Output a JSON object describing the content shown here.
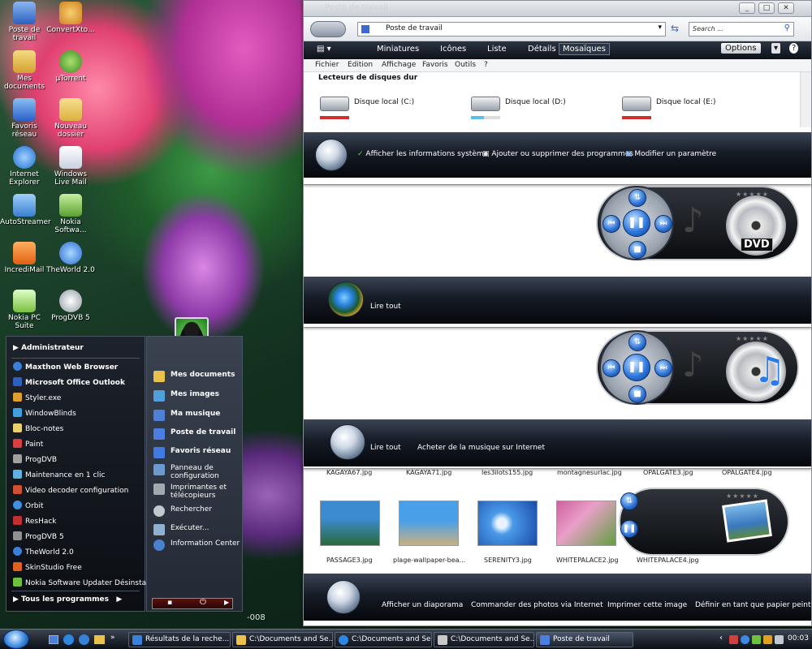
{
  "desktop_icons": [
    {
      "label": "Poste de travail",
      "color": "#4a7ee0"
    },
    {
      "label": "ConvertXto...",
      "color": "#e59a2b"
    },
    {
      "label": "Mes documents",
      "color": "#e8c24a"
    },
    {
      "label": "µTorrent",
      "color": "#6ab04c"
    },
    {
      "label": "Favoris réseau",
      "color": "#3f7be0"
    },
    {
      "label": "Nouveau dossier",
      "color": "#e9c75a"
    },
    {
      "label": "Internet Explorer",
      "color": "#2f86e0"
    },
    {
      "label": "Windows Live Mail",
      "color": "#e8e8f0"
    },
    {
      "label": "AutoStreamer",
      "color": "#56a3e8"
    },
    {
      "label": "Nokia Softwa...",
      "color": "#7dc242"
    },
    {
      "label": "IncrediMail",
      "color": "#f08a2a"
    },
    {
      "label": "TheWorld 2.0",
      "color": "#3a7fd8"
    },
    {
      "label": "Nokia PC Suite",
      "color": "#9bd06a"
    },
    {
      "label": "ProgDVB 5",
      "color": "#cfcfcf"
    }
  ],
  "explorer": {
    "title": "Poste de travail",
    "address": "Poste de travail",
    "search_placeholder": "Search ...",
    "toolbar": {
      "miniatures": "Miniatures",
      "icones": "Icônes",
      "liste": "Liste",
      "details": "Détails",
      "mosaiques": "Mosaïques",
      "options": "Options"
    },
    "menu": [
      "Fichier",
      "Edition",
      "Affichage",
      "Favoris",
      "Outils",
      "?"
    ],
    "group_header": "Lecteurs de disques dur",
    "drives": [
      {
        "label": "Disque local (C:)",
        "bar_color": "#d03030",
        "fill": 1.0
      },
      {
        "label": "Disque local (D:)",
        "bar_color": "#5ac0e8",
        "fill": 0.45
      },
      {
        "label": "Disque local (E:)",
        "bar_color": "#d03030",
        "fill": 1.0
      }
    ],
    "tasks": [
      "Afficher les informations système",
      "Ajouter ou supprimer des programmes",
      "Modifier un paramètre"
    ]
  },
  "video_pane": {
    "stars": "★★★★★",
    "disc_label": "DVD",
    "task": "Lire tout"
  },
  "music_pane": {
    "stars": "★★★★★",
    "tasks": [
      "Lire tout",
      "Acheter de la musique sur Internet"
    ]
  },
  "picture_pane": {
    "top_captions": [
      "KAGAYA67.jpg",
      "KAGAYA71.jpg",
      "les3ilots155.jpg",
      "montagnesurlac.jpg",
      "OPALGATE3.jpg",
      "OPALGATE4.jpg"
    ],
    "thumbs": [
      {
        "caption": "PASSAGE3.jpg",
        "c1": "#3c8ad0",
        "c2": "#2a6a3a"
      },
      {
        "caption": "plage-wallpaper-bea...",
        "c1": "#4aa0e8",
        "c2": "#c8b080"
      },
      {
        "caption": "SERENITY3.jpg",
        "c1": "#2870d8",
        "c2": "#9ad0ff"
      },
      {
        "caption": "WHITEPALACE2.jpg",
        "c1": "#d060a0",
        "c2": "#60a040"
      },
      {
        "caption": "WHITEPALACE4.jpg",
        "c1": "#c8d8f0",
        "c2": "#806898"
      }
    ],
    "stars": "★★★★★",
    "tasks": [
      "Afficher un diaporama",
      "Commander des photos via Internet",
      "Imprimer cette image",
      "Définir en tant que papier peint!"
    ]
  },
  "start_menu": {
    "user": "Administrateur",
    "items": [
      {
        "label": "Maxthon Web Browser",
        "color": "#3a7fd8"
      },
      {
        "label": "Microsoft Office Outlook",
        "color": "#2c5fbf"
      },
      {
        "label": "Styler.exe",
        "color": "#e0a030"
      },
      {
        "label": "WindowBlinds",
        "color": "#3fa0e0"
      },
      {
        "label": "Bloc-notes",
        "color": "#e8d070"
      },
      {
        "label": "Paint",
        "color": "#d84040"
      },
      {
        "label": "ProgDVB",
        "color": "#a0a0a0"
      },
      {
        "label": "Maintenance en 1 clic",
        "color": "#60b0e0"
      },
      {
        "label": "Video decoder configuration",
        "color": "#d05030"
      },
      {
        "label": "Orbit",
        "color": "#4090e0"
      },
      {
        "label": "ResHack",
        "color": "#c03030"
      },
      {
        "label": "ProgDVB 5",
        "color": "#909090"
      },
      {
        "label": "TheWorld 2.0",
        "color": "#3a7fd8"
      },
      {
        "label": "SkinStudio Free",
        "color": "#e06020"
      },
      {
        "label": "Nokia Software Updater Désinsta...",
        "color": "#70c040"
      }
    ],
    "all_programs": "Tous les programmes",
    "right": [
      {
        "label": "Mes documents",
        "color": "#e8c24a"
      },
      {
        "label": "Mes images",
        "color": "#4fa0d8"
      },
      {
        "label": "Ma musique",
        "color": "#4f80d8"
      },
      {
        "label": "Poste de travail",
        "color": "#4a7ee0"
      },
      {
        "label": "Favoris réseau",
        "color": "#3f7be0"
      },
      {
        "label": "Panneau de configuration",
        "color": "#6a9ad0"
      },
      {
        "label": "Imprimantes et télécopieurs",
        "color": "#a0a8b0"
      },
      {
        "label": "Rechercher",
        "color": "#c0c8d0"
      },
      {
        "label": "Exécuter...",
        "color": "#90b0d0"
      },
      {
        "label": "Information Center",
        "color": "#4a80d0"
      }
    ],
    "desk_text": "-008"
  },
  "taskbar": {
    "tasks": [
      {
        "label": "Résultats de la reche...",
        "color": "#3a7fd8"
      },
      {
        "label": "C:\\Documents and Se...",
        "color": "#e8c24a"
      },
      {
        "label": "C:\\Documents and Se...",
        "color": "#2f86e0"
      },
      {
        "label": "C:\\Documents and Se...",
        "color": "#c8c8c8"
      },
      {
        "label": "Poste de travail",
        "color": "#4a7ee0"
      }
    ],
    "clock": "00:03"
  }
}
